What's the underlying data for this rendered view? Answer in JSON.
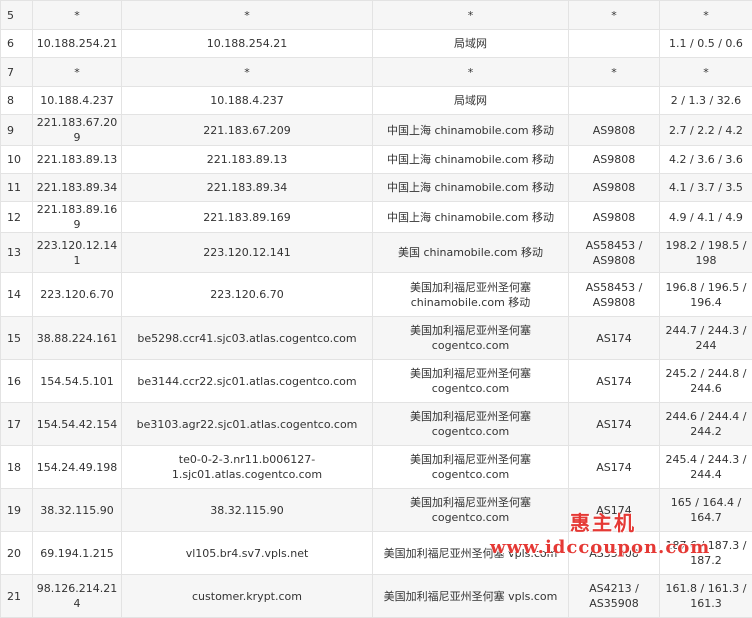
{
  "rows": [
    {
      "hop": "5",
      "ip": "*",
      "hostname": "*",
      "location": "*",
      "as": [
        "*"
      ],
      "latency": "*"
    },
    {
      "hop": "6",
      "ip": "10.188.254.21",
      "hostname": "10.188.254.21",
      "location": "局域网",
      "as": [],
      "latency": "1.1 / 0.5 / 0.6"
    },
    {
      "hop": "7",
      "ip": "*",
      "hostname": "*",
      "location": "*",
      "as": [
        "*"
      ],
      "latency": "*"
    },
    {
      "hop": "8",
      "ip": "10.188.4.237",
      "hostname": "10.188.4.237",
      "location": "局域网",
      "as": [],
      "latency": "2 / 1.3 / 32.6"
    },
    {
      "hop": "9",
      "ip": "221.183.67.209",
      "hostname": "221.183.67.209",
      "location": "中国上海 chinamobile.com 移动",
      "as": [
        "AS9808"
      ],
      "latency": "2.7 / 2.2 / 4.2"
    },
    {
      "hop": "10",
      "ip": "221.183.89.13",
      "hostname": "221.183.89.13",
      "location": "中国上海 chinamobile.com 移动",
      "as": [
        "AS9808"
      ],
      "latency": "4.2 / 3.6 / 3.6"
    },
    {
      "hop": "11",
      "ip": "221.183.89.34",
      "hostname": "221.183.89.34",
      "location": "中国上海 chinamobile.com 移动",
      "as": [
        "AS9808"
      ],
      "latency": "4.1 / 3.7 / 3.5"
    },
    {
      "hop": "12",
      "ip": "221.183.89.169",
      "hostname": "221.183.89.169",
      "location": "中国上海 chinamobile.com 移动",
      "as": [
        "AS9808"
      ],
      "latency": "4.9 / 4.1 / 4.9"
    },
    {
      "hop": "13",
      "ip": "223.120.12.141",
      "hostname": "223.120.12.141",
      "location": "美国 chinamobile.com 移动",
      "as": [
        "AS58453 /",
        "AS9808"
      ],
      "latency": "198.2 / 198.5 / 198"
    },
    {
      "hop": "14",
      "ip": "223.120.6.70",
      "hostname": "223.120.6.70",
      "location": "美国加利福尼亚州圣何塞 chinamobile.com 移动",
      "as": [
        "AS58453 /",
        "AS9808"
      ],
      "latency": "196.8 / 196.5 / 196.4"
    },
    {
      "hop": "15",
      "ip": "38.88.224.161",
      "hostname": "be5298.ccr41.sjc03.atlas.cogentco.com",
      "location": "美国加利福尼亚州圣何塞 cogentco.com",
      "as": [
        "AS174"
      ],
      "latency": "244.7 / 244.3 / 244"
    },
    {
      "hop": "16",
      "ip": "154.54.5.101",
      "hostname": "be3144.ccr22.sjc01.atlas.cogentco.com",
      "location": "美国加利福尼亚州圣何塞 cogentco.com",
      "as": [
        "AS174"
      ],
      "latency": "245.2 / 244.8 / 244.6"
    },
    {
      "hop": "17",
      "ip": "154.54.42.154",
      "hostname": "be3103.agr22.sjc01.atlas.cogentco.com",
      "location": "美国加利福尼亚州圣何塞 cogentco.com",
      "as": [
        "AS174"
      ],
      "latency": "244.6 / 244.4 / 244.2"
    },
    {
      "hop": "18",
      "ip": "154.24.49.198",
      "hostname": "te0-0-2-3.nr11.b006127-1.sjc01.atlas.cogentco.com",
      "location": "美国加利福尼亚州圣何塞 cogentco.com",
      "as": [
        "AS174"
      ],
      "latency": "245.4 / 244.3 / 244.4"
    },
    {
      "hop": "19",
      "ip": "38.32.115.90",
      "hostname": "38.32.115.90",
      "location": "美国加利福尼亚州圣何塞 cogentco.com",
      "as": [
        "AS174"
      ],
      "latency": "165 / 164.4 / 164.7"
    },
    {
      "hop": "20",
      "ip": "69.194.1.215",
      "hostname": "vl105.br4.sv7.vpls.net",
      "location": "美国加利福尼亚州圣何塞 vpls.com",
      "as": [
        "AS35908"
      ],
      "latency": "187.6 / 187.3 / 187.2"
    },
    {
      "hop": "21",
      "ip": "98.126.214.214",
      "hostname": "customer.krypt.com",
      "location": "美国加利福尼亚州圣何塞 vpls.com",
      "as": [
        "AS4213 /",
        "AS35908"
      ],
      "latency": "161.8 / 161.3 / 161.3"
    }
  ],
  "watermark": {
    "brand": "惠主机",
    "url": "www.idccoupon.com"
  },
  "colors": {
    "link": "#2b7fc4",
    "border": "#e3e3e3",
    "row_alt": "#f6f6f6",
    "watermark": "#e53935"
  }
}
